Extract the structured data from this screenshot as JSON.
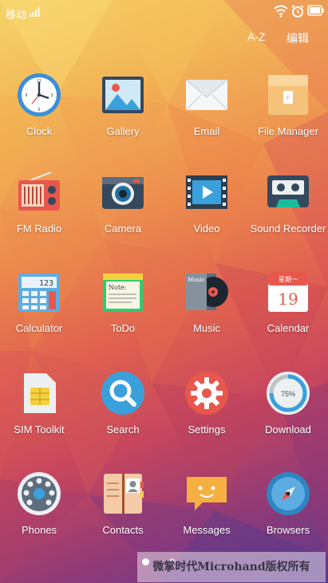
{
  "status_bar": {
    "carrier": "移动",
    "icons": [
      "signal-icon",
      "wifi-icon",
      "alarm-icon",
      "battery-icon"
    ]
  },
  "top_actions": {
    "sort_label": "A-Z",
    "edit_label": "编辑"
  },
  "apps": [
    {
      "name": "Clock"
    },
    {
      "name": "Gallery"
    },
    {
      "name": "Email"
    },
    {
      "name": "File Manager"
    },
    {
      "name": "FM Radio"
    },
    {
      "name": "Camera"
    },
    {
      "name": "Video"
    },
    {
      "name": "Sound Recorder"
    },
    {
      "name": "Calculator"
    },
    {
      "name": "ToDo"
    },
    {
      "name": "Music"
    },
    {
      "name": "Calendar"
    },
    {
      "name": "SIM Toolkit"
    },
    {
      "name": "Search"
    },
    {
      "name": "Settings"
    },
    {
      "name": "Download"
    },
    {
      "name": "Phones"
    },
    {
      "name": "Contacts"
    },
    {
      "name": "Messages"
    },
    {
      "name": "Browsers"
    }
  ],
  "icon_text": {
    "calculator_display": "123",
    "todo_note": "Note:",
    "music_cover": "Music",
    "calendar_weekday": "星期一",
    "calendar_day": "19",
    "download_percent": "75%"
  },
  "pager": {
    "current_page": 1,
    "total_pages": 2
  },
  "watermark": "微掌时代Microhand版权所有",
  "colors": {
    "accent_red": "#e8574c",
    "icon_blue": "#3aa0dc",
    "text": "#ffffff"
  }
}
